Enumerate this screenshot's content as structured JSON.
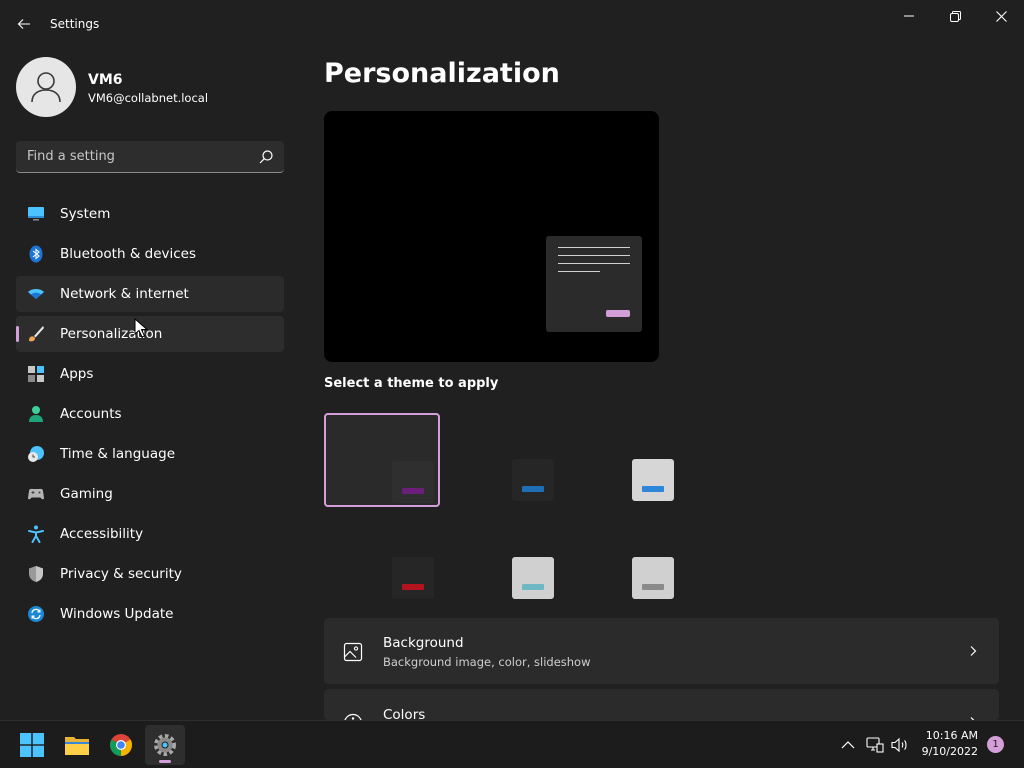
{
  "window": {
    "title": "Settings"
  },
  "user": {
    "name": "VM6",
    "email": "VM6@collabnet.local"
  },
  "search": {
    "placeholder": "Find a setting"
  },
  "sidebar": {
    "items": [
      {
        "label": "System",
        "icon": "system-icon"
      },
      {
        "label": "Bluetooth & devices",
        "icon": "bluetooth-icon"
      },
      {
        "label": "Network & internet",
        "icon": "network-icon"
      },
      {
        "label": "Personalization",
        "icon": "paintbrush-icon"
      },
      {
        "label": "Apps",
        "icon": "apps-icon"
      },
      {
        "label": "Accounts",
        "icon": "accounts-icon"
      },
      {
        "label": "Time & language",
        "icon": "time-language-icon"
      },
      {
        "label": "Gaming",
        "icon": "gamepad-icon"
      },
      {
        "label": "Accessibility",
        "icon": "accessibility-icon"
      },
      {
        "label": "Privacy & security",
        "icon": "shield-icon"
      },
      {
        "label": "Windows Update",
        "icon": "update-icon"
      }
    ],
    "selected": "Personalization",
    "hovered": "Network & internet"
  },
  "main": {
    "title": "Personalization",
    "theme_section_label": "Select a theme to apply",
    "themes": [
      {
        "bg": "#2a2a2a",
        "window": "#2f2f2f",
        "accent": "#6b1f7a",
        "selected": true
      },
      {
        "bg": "#202020",
        "window": "#262626",
        "accent": "#1f6fb8",
        "selected": false
      },
      {
        "bg": "#202020",
        "window": "#d6d6d6",
        "accent": "#2e86d8",
        "selected": false
      },
      {
        "bg": "#202020",
        "window": "#262626",
        "accent": "#b3141e",
        "selected": false
      },
      {
        "bg": "#202020",
        "window": "#d0d0d0",
        "accent": "#6fb7c4",
        "selected": false
      },
      {
        "bg": "#202020",
        "window": "#d0d0d0",
        "accent": "#8a8a8a",
        "selected": false
      }
    ],
    "cards": [
      {
        "title": "Background",
        "subtitle": "Background image, color, slideshow",
        "icon": "image-icon"
      },
      {
        "title": "Colors",
        "subtitle": "",
        "icon": "palette-icon"
      }
    ]
  },
  "taskbar": {
    "apps": [
      "start-icon",
      "file-explorer-icon",
      "chrome-icon",
      "settings-icon"
    ],
    "time": "10:16 AM",
    "date": "9/10/2022",
    "notification_count": "1"
  },
  "colors": {
    "accent": "#d49fd9",
    "background": "#202020",
    "card": "#2b2b2b"
  }
}
